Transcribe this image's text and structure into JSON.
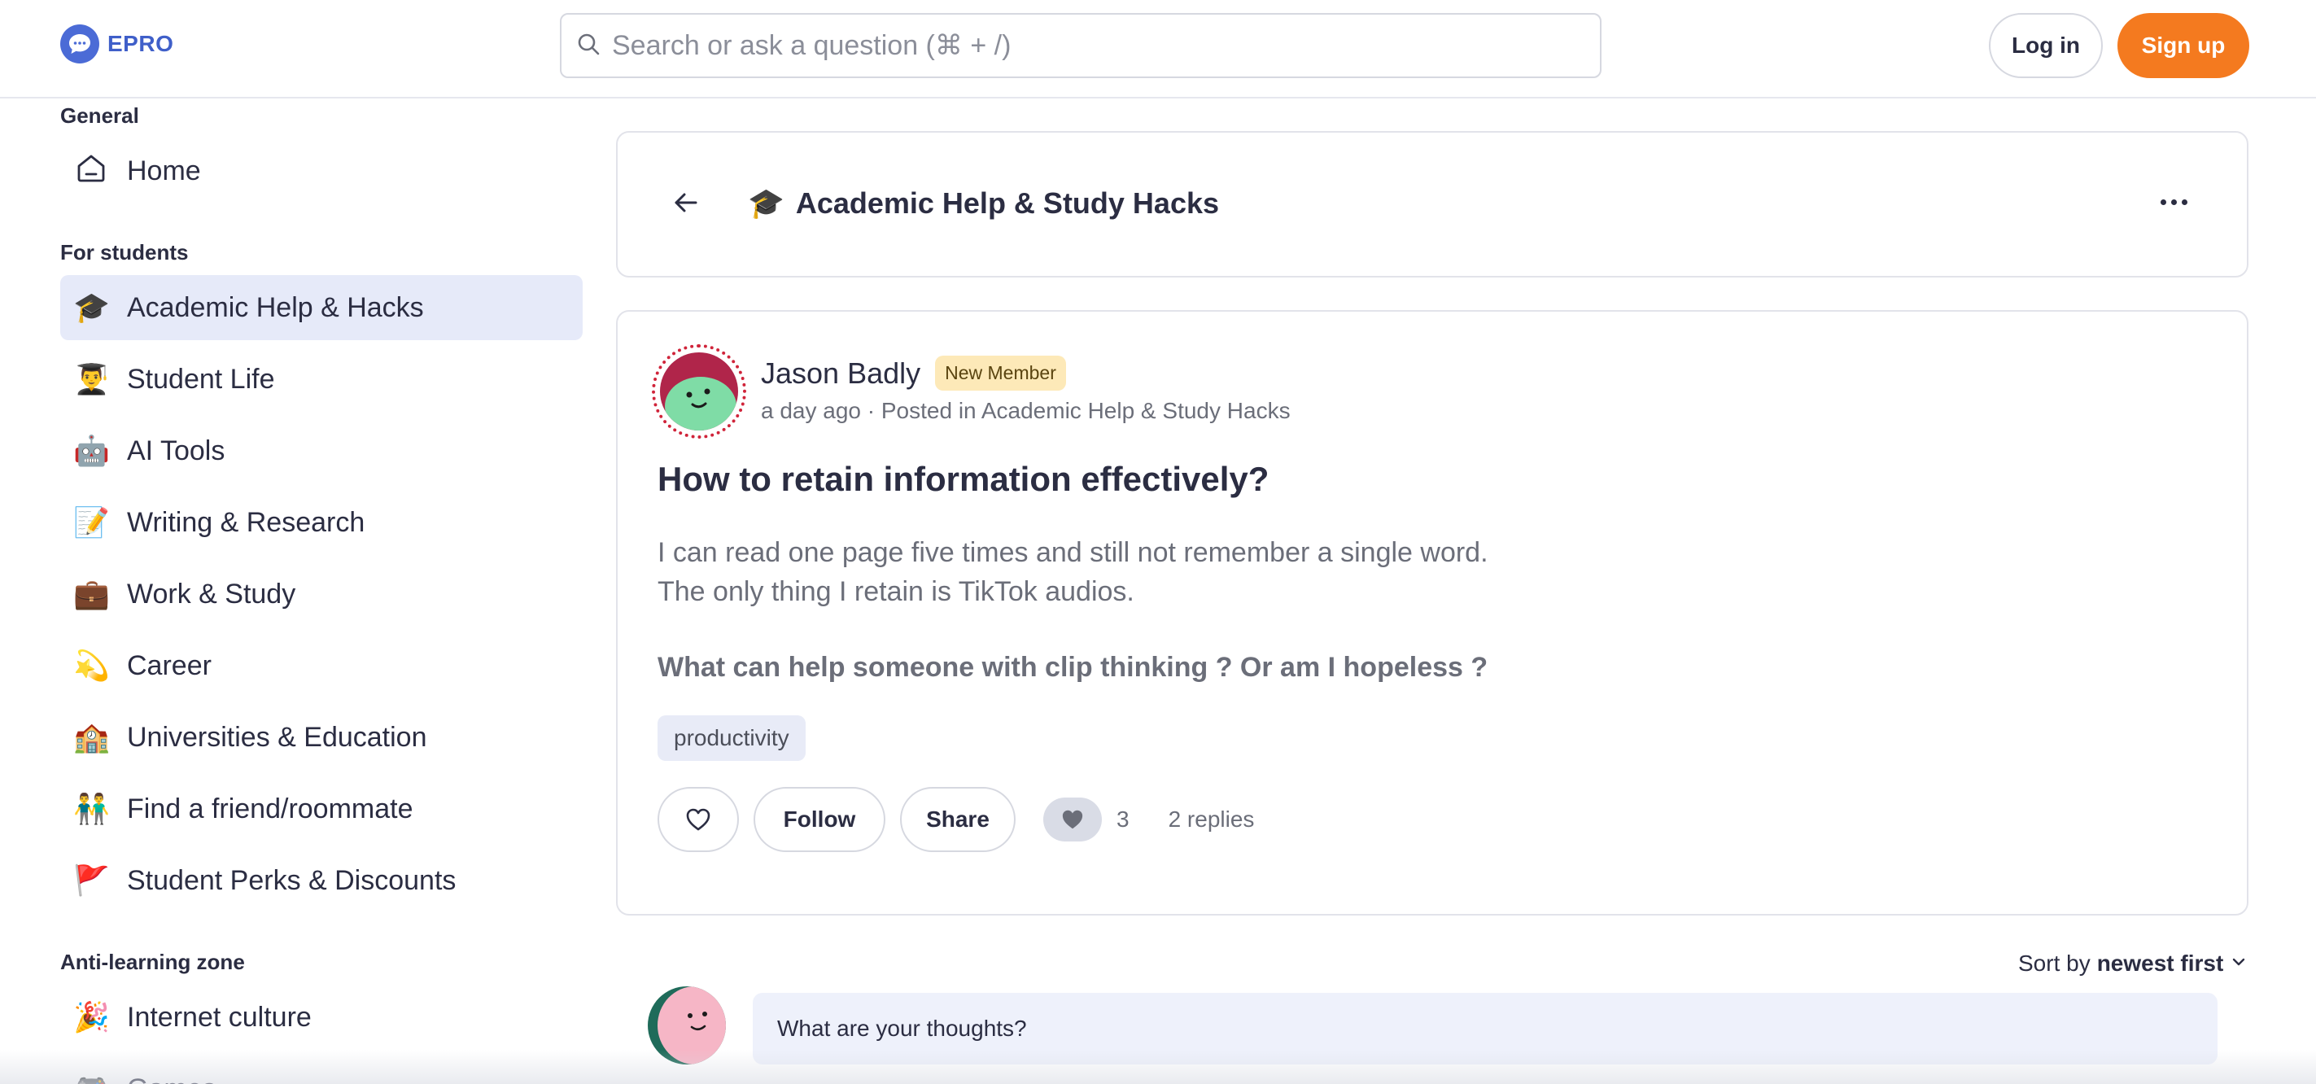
{
  "header": {
    "logo_text": "EPRO",
    "search_placeholder": "Search or ask a question (⌘ + /)",
    "login_label": "Log in",
    "signup_label": "Sign up"
  },
  "sidebar": {
    "general_heading": "General",
    "home_label": "Home",
    "students_heading": "For students",
    "student_items": [
      {
        "emoji": "🎓",
        "label": "Academic Help & Hacks"
      },
      {
        "emoji": "👨‍🎓",
        "label": "Student Life"
      },
      {
        "emoji": "🤖",
        "label": "AI Tools"
      },
      {
        "emoji": "📝",
        "label": "Writing & Research"
      },
      {
        "emoji": "💼",
        "label": "Work & Study"
      },
      {
        "emoji": "💫",
        "label": "Career"
      },
      {
        "emoji": "🏫",
        "label": "Universities & Education"
      },
      {
        "emoji": "👬",
        "label": "Find a friend/roommate"
      },
      {
        "emoji": "🚩",
        "label": "Student Perks & Discounts"
      }
    ],
    "anti_heading": "Anti-learning zone",
    "anti_items": [
      {
        "emoji": "🎉",
        "label": "Internet culture"
      },
      {
        "emoji": "🎮",
        "label": "Games"
      }
    ]
  },
  "topic": {
    "emoji": "🎓",
    "title": "Academic Help & Study Hacks"
  },
  "post": {
    "author": "Jason Badly",
    "badge": "New Member",
    "meta": "a day ago · Posted in Academic Help & Study Hacks",
    "title": "How to retain information effectively?",
    "body_line1": "I can read one page five times and still not remember a single word.",
    "body_line2": "The only thing I retain is TikTok audios.",
    "question": "What can help someone with clip thinking ? Or am I hopeless ?",
    "tag": "productivity",
    "follow_label": "Follow",
    "share_label": "Share",
    "likes": "3",
    "replies": "2 replies"
  },
  "comments": {
    "sort_prefix": "Sort by",
    "sort_value": "newest first",
    "reply_placeholder": "What are your thoughts?"
  },
  "colors": {
    "accent": "#f47a1f",
    "brand": "#3f5fc9",
    "active_bg": "#e6eaf9",
    "badge_bg": "#fde9b8"
  }
}
